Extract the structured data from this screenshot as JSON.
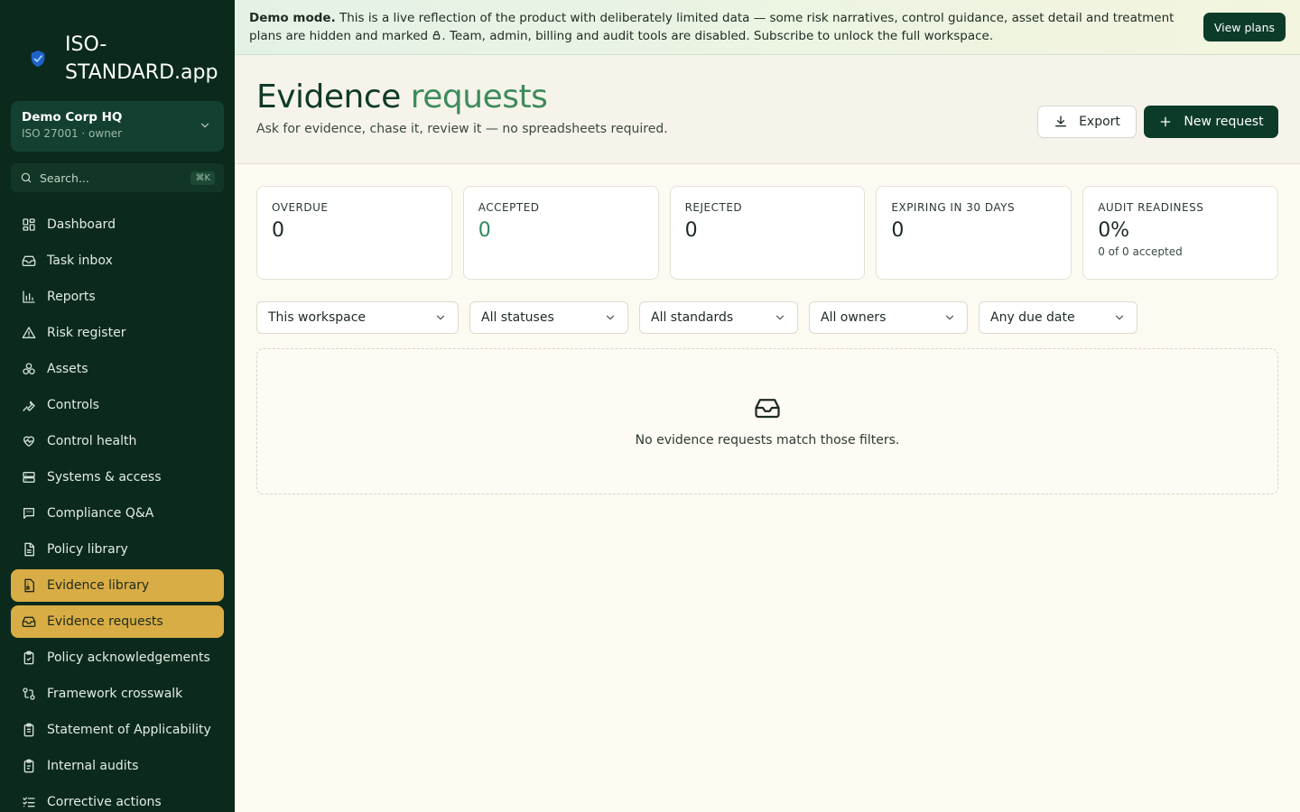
{
  "app": {
    "name": "ISO-STANDARD.app"
  },
  "workspace": {
    "name": "Demo Corp HQ",
    "subtitle": "ISO 27001 · owner"
  },
  "search": {
    "placeholder": "Search...",
    "shortcut": "⌘K"
  },
  "sidebar": {
    "items": [
      {
        "label": "Dashboard",
        "icon": "dashboard-icon"
      },
      {
        "label": "Task inbox",
        "icon": "inbox-icon"
      },
      {
        "label": "Reports",
        "icon": "bar-chart-icon"
      },
      {
        "label": "Risk register",
        "icon": "warning-icon"
      },
      {
        "label": "Assets",
        "icon": "boxes-icon"
      },
      {
        "label": "Controls",
        "icon": "wrench-icon"
      },
      {
        "label": "Control health",
        "icon": "heart-pulse-icon"
      },
      {
        "label": "Systems & access",
        "icon": "server-icon"
      },
      {
        "label": "Compliance Q&A",
        "icon": "chat-icon"
      },
      {
        "label": "Policy library",
        "icon": "document-icon"
      },
      {
        "label": "Evidence library",
        "icon": "file-archive-icon"
      },
      {
        "label": "Evidence requests",
        "icon": "inbox-icon"
      },
      {
        "label": "Policy acknowledgements",
        "icon": "clipboard-check-icon"
      },
      {
        "label": "Framework crosswalk",
        "icon": "crosswalk-icon"
      },
      {
        "label": "Statement of Applicability",
        "icon": "clipboard-list-icon"
      },
      {
        "label": "Internal audits",
        "icon": "clipboard-icon"
      },
      {
        "label": "Corrective actions",
        "icon": "checklist-icon"
      }
    ]
  },
  "banner": {
    "strong": "Demo mode.",
    "text_before_icon": " This is a live reflection of the product with deliberately limited data — some risk narratives, control guidance, asset detail and treatment plans are hidden and marked ",
    "text_after_icon": ". Team, admin, billing and audit tools are disabled. Subscribe to unlock the full workspace.",
    "cta": "View plans"
  },
  "header": {
    "title_part1": "Evidence ",
    "title_part2": "requests",
    "subtitle": "Ask for evidence, chase it, review it — no spreadsheets required.",
    "export_label": "Export",
    "new_label": "New request"
  },
  "stats": [
    {
      "label": "OVERDUE",
      "value": "0"
    },
    {
      "label": "ACCEPTED",
      "value": "0"
    },
    {
      "label": "REJECTED",
      "value": "0"
    },
    {
      "label": "EXPIRING IN 30 DAYS",
      "value": "0"
    },
    {
      "label": "AUDIT READINESS",
      "value": "0%",
      "note": "0 of 0 accepted"
    }
  ],
  "filters": {
    "workspace": "This workspace",
    "status": "All statuses",
    "standard": "All standards",
    "owner": "All owners",
    "due": "Any due date"
  },
  "empty": {
    "message": "No evidence requests match those filters."
  },
  "colors": {
    "sidebar": "#0b2a1c",
    "accent": "#d9ad45",
    "primary": "#0d3b2a",
    "green": "#2f8a5e"
  }
}
